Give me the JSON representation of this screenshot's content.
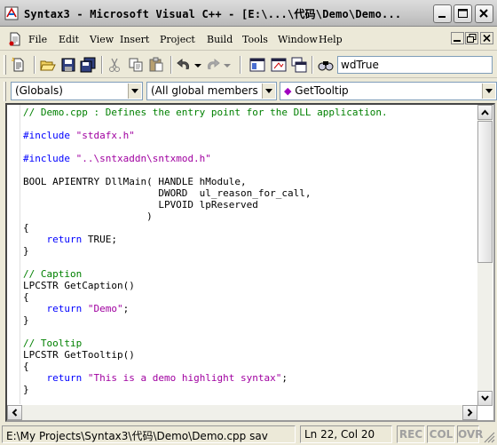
{
  "window": {
    "title": "Syntax3 - Microsoft Visual C++ - [E:\\...\\代码\\Demo\\Demo..."
  },
  "menu": {
    "items": [
      "File",
      "Edit",
      "View",
      "Insert",
      "Project",
      "Build",
      "Tools",
      "Window",
      "Help"
    ]
  },
  "toolbar": {
    "find_value": "wdTrue"
  },
  "wizardbar": {
    "class_combo": "(Globals)",
    "filter_combo": "(All global members",
    "member_combo": "GetTooltip"
  },
  "code": {
    "lines": [
      {
        "text": "// Demo.cpp : Defines the entry point for the DLL application.",
        "kind": "comment"
      },
      {
        "text": "",
        "kind": "plain"
      },
      {
        "pre": "#include ",
        "str": "\"stdafx.h\"",
        "kind": "include"
      },
      {
        "text": "",
        "kind": "plain"
      },
      {
        "pre": "#include ",
        "str": "\"..\\sntxaddn\\sntxmod.h\"",
        "kind": "include"
      },
      {
        "text": "",
        "kind": "plain"
      },
      {
        "text": "BOOL APIENTRY DllMain( HANDLE hModule,",
        "kind": "plain"
      },
      {
        "text": "                       DWORD  ul_reason_for_call,",
        "kind": "plain"
      },
      {
        "text": "                       LPVOID lpReserved",
        "kind": "plain"
      },
      {
        "text": "                     )",
        "kind": "plain"
      },
      {
        "text": "{",
        "kind": "plain"
      },
      {
        "kw": "    return ",
        "rest": "TRUE;",
        "kind": "return"
      },
      {
        "text": "}",
        "kind": "plain"
      },
      {
        "text": "",
        "kind": "plain"
      },
      {
        "text": "// Caption",
        "kind": "comment"
      },
      {
        "text": "LPCSTR GetCaption()",
        "kind": "plain"
      },
      {
        "text": "{",
        "kind": "plain"
      },
      {
        "kw": "    return ",
        "str": "\"Demo\"",
        "rest": ";",
        "kind": "return-str"
      },
      {
        "text": "}",
        "kind": "plain"
      },
      {
        "text": "",
        "kind": "plain"
      },
      {
        "text": "// Tooltip",
        "kind": "comment"
      },
      {
        "text": "LPCSTR GetTooltip()",
        "kind": "plain"
      },
      {
        "text": "{",
        "kind": "plain"
      },
      {
        "kw": "    return ",
        "str": "\"This is a demo highlight syntax\"",
        "rest": ";",
        "kind": "return-str"
      },
      {
        "text": "}",
        "kind": "plain"
      }
    ]
  },
  "status": {
    "message": "E:\\My Projects\\Syntax3\\代码\\Demo\\Demo.cpp sav",
    "position": "Ln 22, Col 20",
    "indicators": [
      "REC",
      "COL",
      "OVR"
    ]
  },
  "colors": {
    "comment": "#008000",
    "preprocessor": "#0000ff",
    "string": "#a000a0",
    "keyword": "#0000ff"
  }
}
